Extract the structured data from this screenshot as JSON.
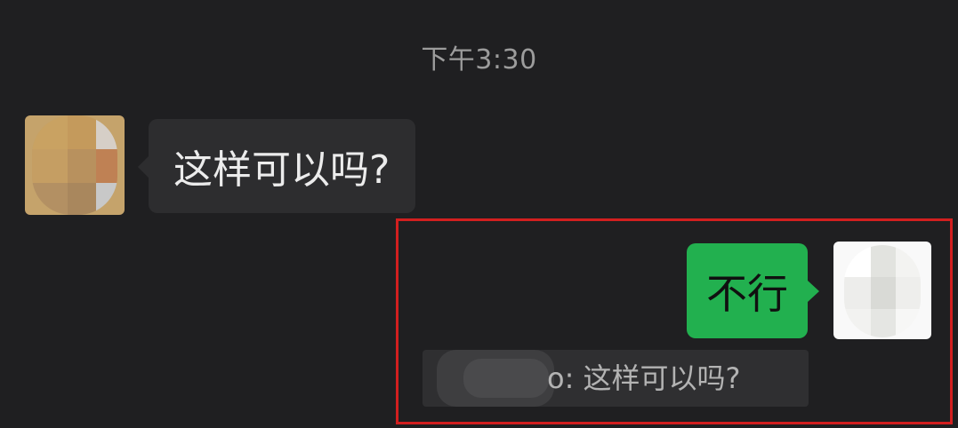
{
  "chat": {
    "timestamp": "下午3:30",
    "messages": [
      {
        "direction": "incoming",
        "text": "这样可以吗?",
        "avatar": {
          "obscured": true,
          "colors": [
            "#c9a262",
            "#d6cfc7",
            "#bf8154",
            "#b39063",
            "#a9875d",
            "#c8c8c8"
          ]
        }
      },
      {
        "direction": "outgoing",
        "text": "不行",
        "bubble_color": "#22b04f",
        "avatar": {
          "obscured": true,
          "colors": [
            "#ffffff",
            "#e2e3df",
            "#ededeb",
            "#d9dad6",
            "#e5e6e3",
            "#f3f3f1"
          ]
        },
        "quote": {
          "sender_suffix": "o",
          "text": "o: 这样可以吗?",
          "sender_obscured": true
        }
      }
    ],
    "highlight_color": "#d21f1f"
  }
}
